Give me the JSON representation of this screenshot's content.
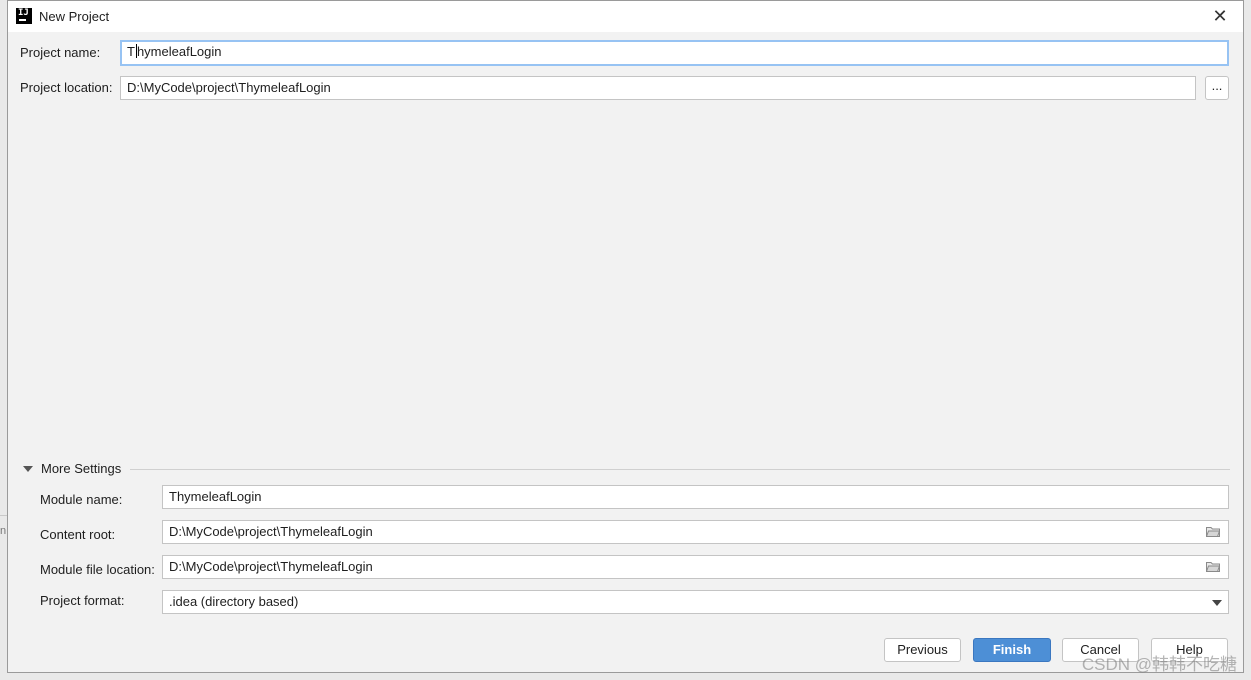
{
  "window": {
    "title": "New Project",
    "close_glyph": "✕"
  },
  "project": {
    "name_label": "Project name:",
    "name_value": "ThymeleafLogin",
    "location_label": "Project location:",
    "location_value": "D:\\MyCode\\project\\ThymeleafLogin",
    "browse_label": "..."
  },
  "more_settings": {
    "title": "More Settings",
    "module_name_label": "Module name:",
    "module_name_value": "ThymeleafLogin",
    "content_root_label": "Content root:",
    "content_root_value": "D:\\MyCode\\project\\ThymeleafLogin",
    "module_file_label": "Module file location:",
    "module_file_value": "D:\\MyCode\\project\\ThymeleafLogin",
    "format_label": "Project format:",
    "format_value": ".idea (directory based)"
  },
  "buttons": {
    "previous": "Previous",
    "finish": "Finish",
    "cancel": "Cancel",
    "help": "Help"
  },
  "watermark": "CSDN @韩韩不吃糖",
  "colors": {
    "accent": "#4d8fd6",
    "focus_border": "#97c3f3",
    "dialog_bg": "#f2f2f2"
  }
}
